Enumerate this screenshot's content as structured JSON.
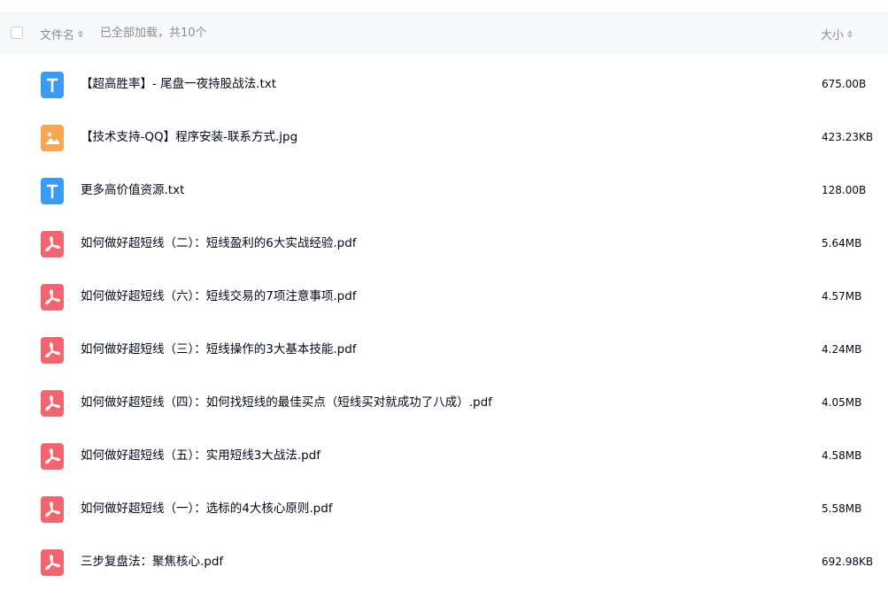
{
  "header": {
    "col_name": "文件名",
    "load_status": "已全部加载，共10个",
    "col_size": "大小"
  },
  "files": [
    {
      "name": "【超高胜率】- 尾盘一夜持股战法.txt",
      "size": "675.00B",
      "icon": "txt-file-icon"
    },
    {
      "name": "【技术支持-QQ】程序安装-联系方式.jpg",
      "size": "423.23KB",
      "icon": "image-file-icon"
    },
    {
      "name": "更多高价值资源.txt",
      "size": "128.00B",
      "icon": "txt-file-icon"
    },
    {
      "name": "如何做好超短线（二）：短线盈利的6大实战经验.pdf",
      "size": "5.64MB",
      "icon": "pdf-file-icon"
    },
    {
      "name": "如何做好超短线（六）：短线交易的7项注意事项.pdf",
      "size": "4.57MB",
      "icon": "pdf-file-icon"
    },
    {
      "name": "如何做好超短线（三）：短线操作的3大基本技能.pdf",
      "size": "4.24MB",
      "icon": "pdf-file-icon"
    },
    {
      "name": "如何做好超短线（四）：如何找短线的最佳买点（短线买对就成功了八成）.pdf",
      "size": "4.05MB",
      "icon": "pdf-file-icon"
    },
    {
      "name": "如何做好超短线（五）：实用短线3大战法.pdf",
      "size": "4.58MB",
      "icon": "pdf-file-icon"
    },
    {
      "name": "如何做好超短线（一）：选标的4大核心原则.pdf",
      "size": "5.58MB",
      "icon": "pdf-file-icon"
    },
    {
      "name": "三步复盘法：聚焦核心.pdf",
      "size": "692.98KB",
      "icon": "pdf-file-icon"
    }
  ],
  "colors": {
    "txt_icon": "#3a9bf5",
    "image_icon": "#f9a552",
    "pdf_icon": "#f26570",
    "header_bg": "#f7f8fa",
    "muted_text": "#878c9c"
  }
}
